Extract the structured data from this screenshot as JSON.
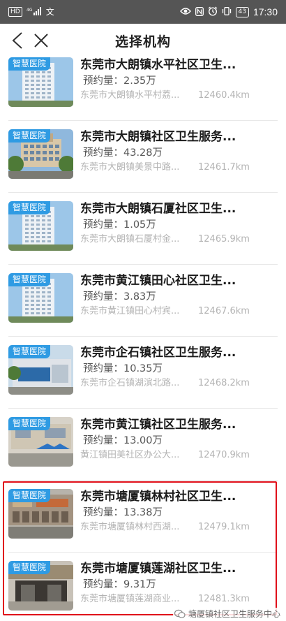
{
  "status_bar": {
    "left_icons": [
      "hd-icon",
      "signal-icon",
      "translate-icon"
    ],
    "left_labels": [
      "HD",
      "4G",
      "文"
    ],
    "battery": "43",
    "time": "17:30"
  },
  "header": {
    "title": "选择机构"
  },
  "booking_label": "预约量：",
  "items": [
    {
      "tag": "智慧医院",
      "name": "东莞市大朗镇水平社区卫生...",
      "booking": "2.35万",
      "address": "东莞市大朗镇水平村荔...",
      "distance": "12460.4km"
    },
    {
      "tag": "智慧医院",
      "name": "东莞市大朗镇社区卫生服务...",
      "booking": "43.28万",
      "address": "东莞市大朗镇美景中路...",
      "distance": "12461.7km"
    },
    {
      "tag": "智慧医院",
      "name": "东莞市大朗镇石厦社区卫生...",
      "booking": "1.05万",
      "address": "东莞市大朗镇石厦村金...",
      "distance": "12465.9km"
    },
    {
      "tag": "智慧医院",
      "name": "东莞市黄江镇田心社区卫生...",
      "booking": "3.83万",
      "address": "东莞市黄江镇田心村宾...",
      "distance": "12467.6km"
    },
    {
      "tag": "智慧医院",
      "name": "东莞市企石镇社区卫生服务...",
      "booking": "10.35万",
      "address": "东莞市企石镇湖滨北路...",
      "distance": "12468.2km"
    },
    {
      "tag": "智慧医院",
      "name": "东莞市黄江镇社区卫生服务...",
      "booking": "13.00万",
      "address": "黄江镇田美社区办公大...",
      "distance": "12470.9km"
    },
    {
      "tag": "智慧医院",
      "name": "东莞市塘厦镇林村社区卫生...",
      "booking": "13.38万",
      "address": "东莞市塘厦镇林村西湖...",
      "distance": "12479.1km"
    },
    {
      "tag": "智慧医院",
      "name": "东莞市塘厦镇莲湖社区卫生...",
      "booking": "9.31万",
      "address": "东莞市塘厦镇莲湖商业...",
      "distance": "12481.3km"
    }
  ],
  "watermark": "塘厦镇社区卫生服务中心",
  "colors": {
    "status_bar": "#555555",
    "tag": "#2f9be3",
    "highlight": "#e0101a"
  }
}
